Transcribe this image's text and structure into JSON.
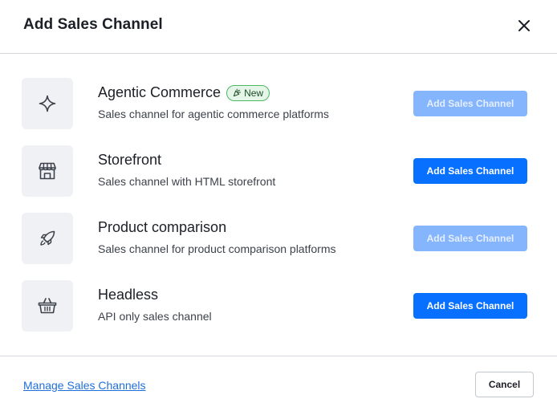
{
  "dialog": {
    "title": "Add Sales Channel",
    "close_icon": "close-icon"
  },
  "channels": [
    {
      "title": "Agentic Commerce",
      "badge": "New",
      "badge_icon": "party-popper-icon",
      "description": "Sales channel for agentic commerce platforms",
      "icon": "sparkle-icon",
      "button_label": "Add Sales Channel",
      "button_disabled": true
    },
    {
      "title": "Storefront",
      "description": "Sales channel with HTML storefront",
      "icon": "storefront-icon",
      "button_label": "Add Sales Channel",
      "button_disabled": false
    },
    {
      "title": "Product comparison",
      "description": "Sales channel for product comparison platforms",
      "icon": "rocket-icon",
      "button_label": "Add Sales Channel",
      "button_disabled": true
    },
    {
      "title": "Headless",
      "description": "API only sales channel",
      "icon": "basket-icon",
      "button_label": "Add Sales Channel",
      "button_disabled": false
    }
  ],
  "footer": {
    "manage_link": "Manage Sales Channels",
    "cancel_label": "Cancel"
  },
  "colors": {
    "primary": "#0870ff",
    "primary_disabled": "#85b5fc",
    "badge_border": "#4bb863",
    "badge_bg": "#e5f6e8",
    "link": "#1f6fd9"
  }
}
